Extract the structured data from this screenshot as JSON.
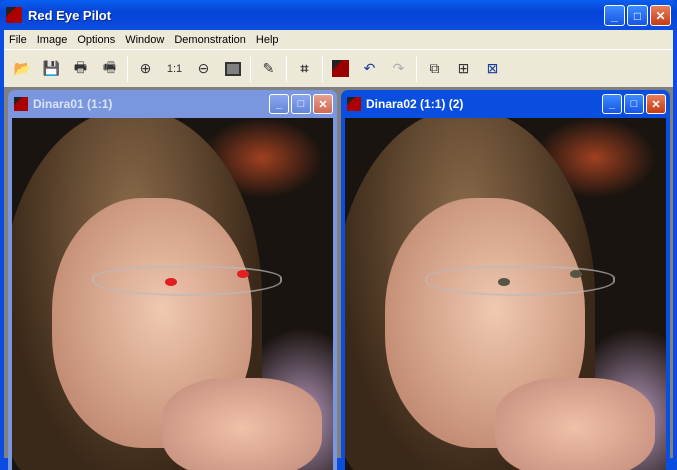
{
  "app": {
    "title": "Red Eye Pilot"
  },
  "menu": [
    "File",
    "Image",
    "Options",
    "Window",
    "Demonstration",
    "Help"
  ],
  "toolbar": {
    "zoom_actual": "1:1"
  },
  "windows": [
    {
      "title": "Dinara01 (1:1)",
      "active": false,
      "red_eyes": true
    },
    {
      "title": "Dinara02 (1:1) (2)",
      "active": true,
      "red_eyes": false
    }
  ]
}
